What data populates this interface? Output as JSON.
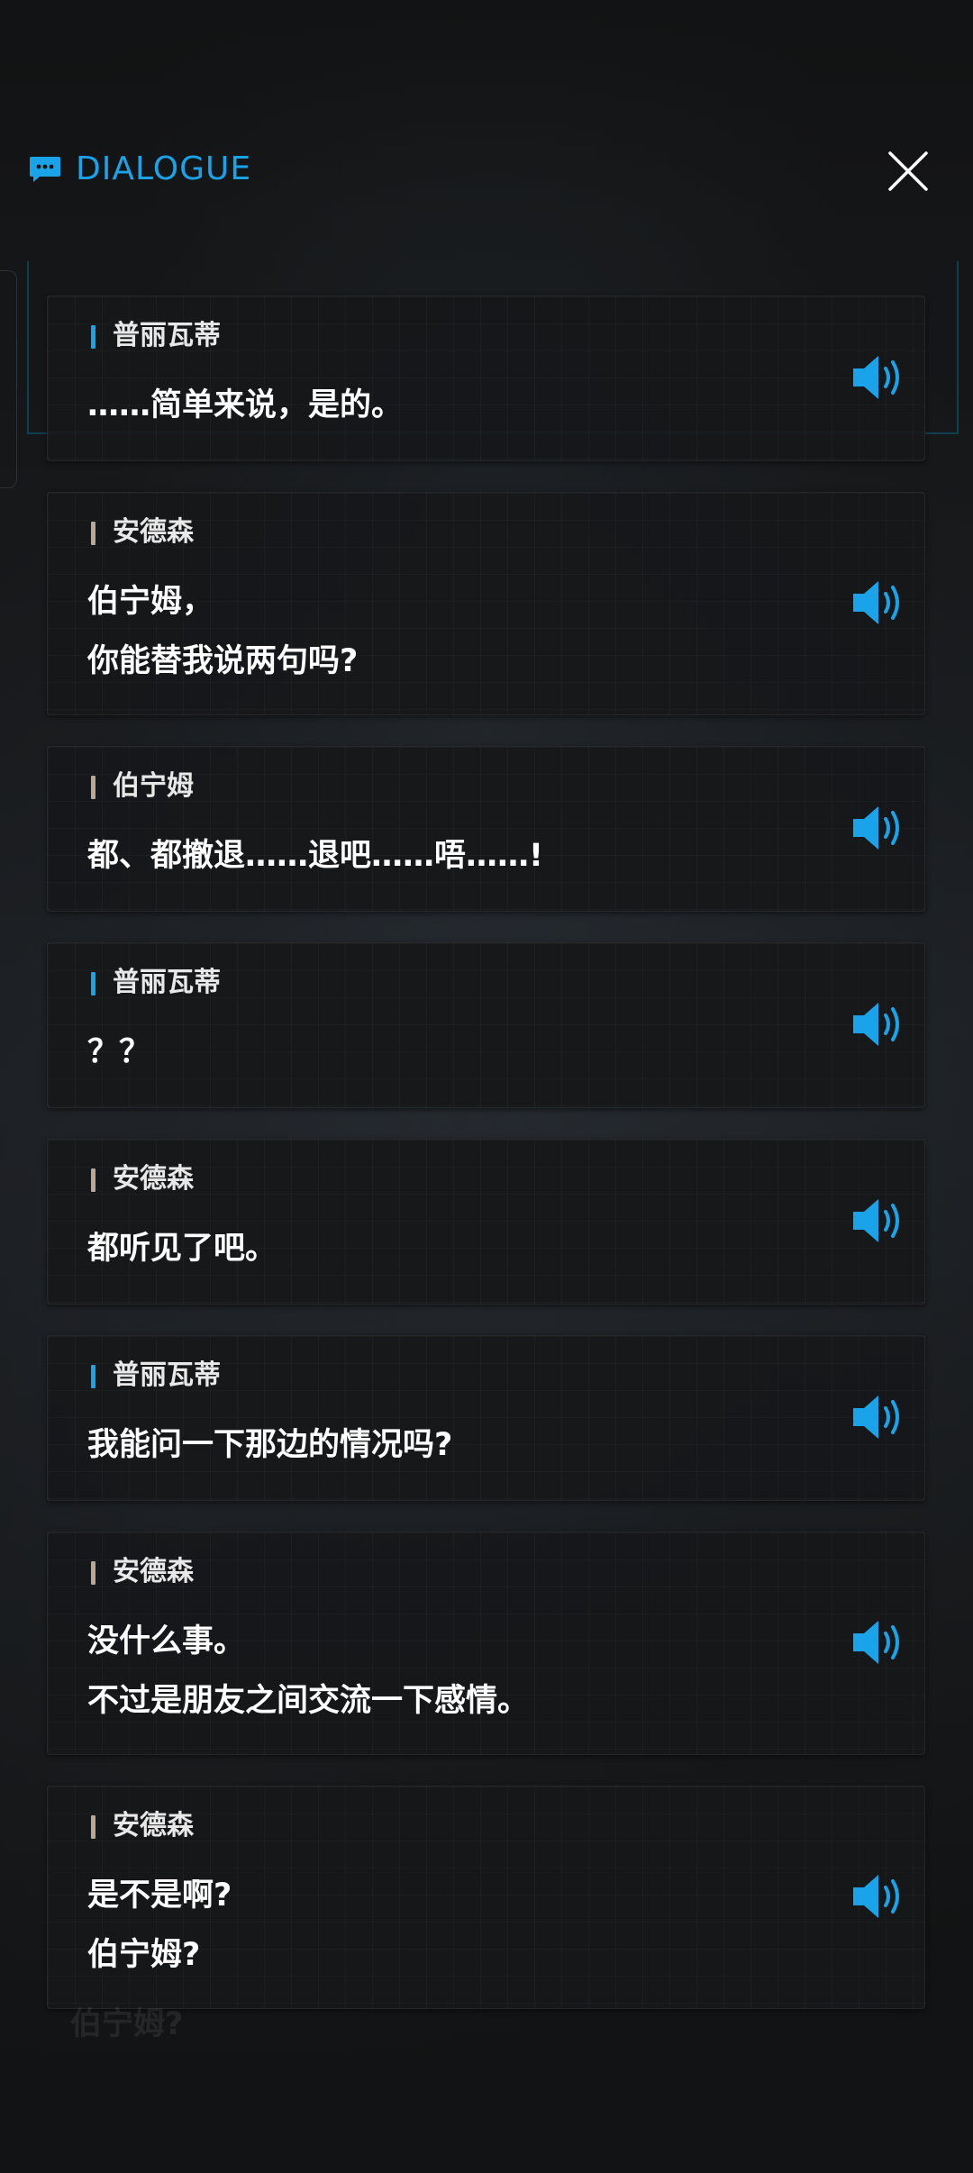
{
  "header": {
    "title": "DIALOGUE",
    "icon": "chat-bubble-icon",
    "close_icon": "close-icon"
  },
  "colors": {
    "accent": "#1aa3e8",
    "speaker_blue": "#1aa3e8",
    "speaker_tan": "#b8a89a"
  },
  "dialogue": [
    {
      "speaker": "普丽瓦蒂",
      "speaker_color": "blue",
      "lines": [
        "……简单来说，是的。"
      ],
      "voice_icon": "speaker-icon"
    },
    {
      "speaker": "安德森",
      "speaker_color": "tan",
      "lines": [
        "伯宁姆，",
        "你能替我说两句吗?"
      ],
      "voice_icon": "speaker-icon"
    },
    {
      "speaker": "伯宁姆",
      "speaker_color": "tan",
      "lines": [
        "都、都撤退……退吧……唔……!"
      ],
      "voice_icon": "speaker-icon"
    },
    {
      "speaker": "普丽瓦蒂",
      "speaker_color": "blue",
      "lines": [
        "？？"
      ],
      "voice_icon": "speaker-icon"
    },
    {
      "speaker": "安德森",
      "speaker_color": "tan",
      "lines": [
        "都听见了吧。"
      ],
      "voice_icon": "speaker-icon"
    },
    {
      "speaker": "普丽瓦蒂",
      "speaker_color": "blue",
      "lines": [
        "我能问一下那边的情况吗?"
      ],
      "voice_icon": "speaker-icon"
    },
    {
      "speaker": "安德森",
      "speaker_color": "tan",
      "lines": [
        "没什么事。",
        "不过是朋友之间交流一下感情。"
      ],
      "voice_icon": "speaker-icon"
    },
    {
      "speaker": "安德森",
      "speaker_color": "tan",
      "lines": [
        "是不是啊?",
        "伯宁姆?"
      ],
      "voice_icon": "speaker-icon"
    }
  ],
  "background_text": "伯宁姆?"
}
